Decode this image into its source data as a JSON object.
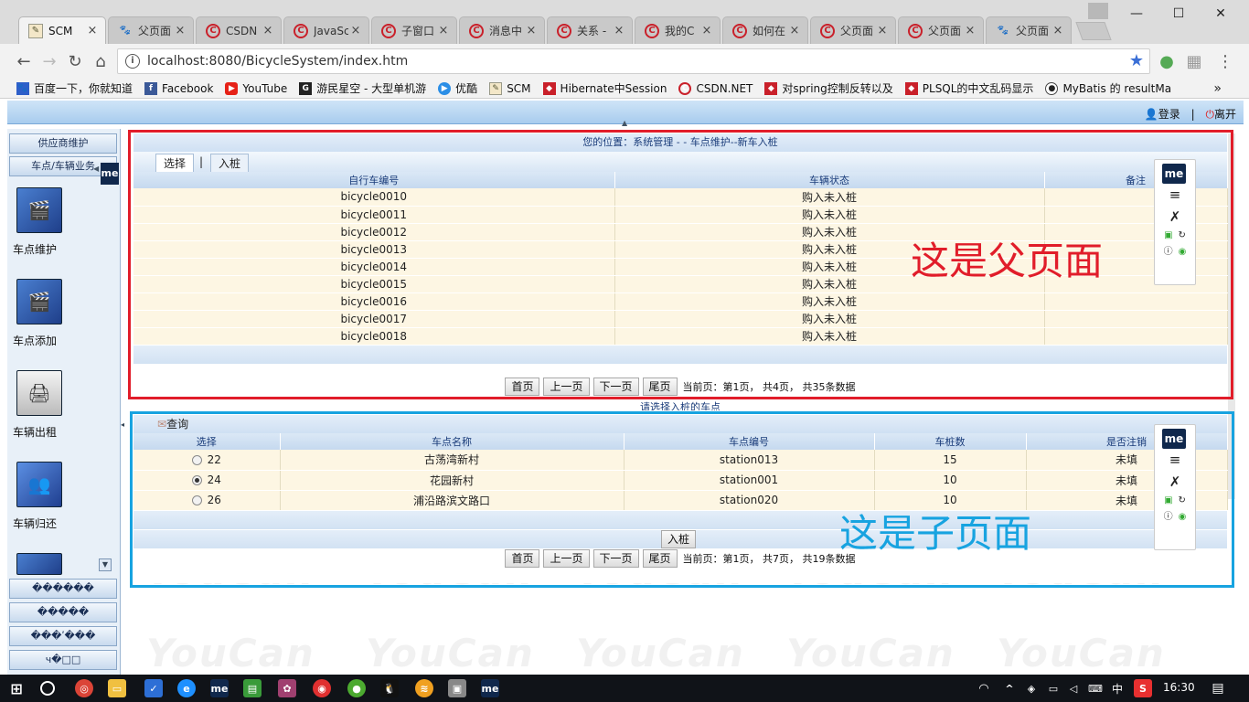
{
  "browser": {
    "tabs": [
      {
        "label": "SCM",
        "icon": "scm-icon",
        "active": true
      },
      {
        "label": "父页面",
        "icon": "baidu-paw-icon"
      },
      {
        "label": "CSDN",
        "icon": "csdn-icon"
      },
      {
        "label": "JavaSc",
        "icon": "csdn-icon"
      },
      {
        "label": "子窗口",
        "icon": "csdn-icon"
      },
      {
        "label": "消息中",
        "icon": "csdn-icon"
      },
      {
        "label": "关系 -",
        "icon": "csdn-icon"
      },
      {
        "label": "我的C",
        "icon": "csdn-icon"
      },
      {
        "label": "如何在",
        "icon": "csdn-icon"
      },
      {
        "label": "父页面",
        "icon": "csdn-icon"
      },
      {
        "label": "父页面",
        "icon": "csdn-icon"
      },
      {
        "label": "父页面",
        "icon": "baidu-paw-icon"
      }
    ],
    "tab_close": "×",
    "url": "localhost:8080/BicycleSystem/index.htm",
    "bookmarks": [
      {
        "label": "百度一下，你就知道"
      },
      {
        "label": "Facebook"
      },
      {
        "label": "YouTube"
      },
      {
        "label": "游民星空 - 大型单机游"
      },
      {
        "label": "优酷"
      },
      {
        "label": "SCM"
      },
      {
        "label": "Hibernate中Session"
      },
      {
        "label": "CSDN.NET"
      },
      {
        "label": "对spring控制反转以及"
      },
      {
        "label": "PLSQL的中文乱码显示"
      },
      {
        "label": "MyBatis 的 resultMa"
      }
    ],
    "bookmarks_more": "»"
  },
  "header": {
    "login": "登录",
    "separator": "|",
    "logout": "离开"
  },
  "sidebar": {
    "top_buttons": [
      "供应商维护",
      "车点/车辆业务"
    ],
    "items": [
      {
        "label": "车点维护"
      },
      {
        "label": "车点添加"
      },
      {
        "label": "车辆出租"
      },
      {
        "label": "车辆归还"
      }
    ],
    "bottom_buttons": [
      "������",
      "�����",
      "���ʹ���",
      "ч�□□"
    ]
  },
  "parent_frame": {
    "breadcrumb": "您的位置：系统管理 -  - 车点维护--新车入桩",
    "tabs": [
      "选择",
      "|",
      "入桩"
    ],
    "columns": [
      "自行车编号",
      "车辆状态",
      "备注"
    ],
    "rows": [
      [
        "bicycle0010",
        "购入未入桩",
        ""
      ],
      [
        "bicycle0011",
        "购入未入桩",
        ""
      ],
      [
        "bicycle0012",
        "购入未入桩",
        ""
      ],
      [
        "bicycle0013",
        "购入未入桩",
        ""
      ],
      [
        "bicycle0014",
        "购入未入桩",
        ""
      ],
      [
        "bicycle0015",
        "购入未入桩",
        ""
      ],
      [
        "bicycle0016",
        "购入未入桩",
        ""
      ],
      [
        "bicycle0017",
        "购入未入桩",
        ""
      ],
      [
        "bicycle0018",
        "购入未入桩",
        ""
      ]
    ],
    "pager": {
      "first": "首页",
      "prev": "上一页",
      "next": "下一页",
      "last": "尾页",
      "info": "当前页：第1页， 共4页， 共35条数据"
    },
    "annotation": "这是父页面"
  },
  "between_caption": "请选择入桩的车点",
  "child_frame": {
    "query": "查询",
    "columns": [
      "选择",
      "车点名称",
      "车点编号",
      "车桩数",
      "是否注销"
    ],
    "rows": [
      {
        "id": "22",
        "name": "古荡湾新村",
        "code": "station013",
        "piles": "15",
        "status": "未填",
        "selected": false
      },
      {
        "id": "24",
        "name": "花园新村",
        "code": "station001",
        "piles": "10",
        "status": "未填",
        "selected": true
      },
      {
        "id": "26",
        "name": "浦沿路滨文路口",
        "code": "station020",
        "piles": "10",
        "status": "未填",
        "selected": false
      }
    ],
    "submit": "入桩",
    "pager": {
      "first": "首页",
      "prev": "上一页",
      "next": "下一页",
      "last": "尾页",
      "info": "当前页：第1页， 共7页， 共19条数据"
    },
    "annotation": "这是子页面"
  },
  "extension": {
    "label": "me"
  },
  "watermark": "YouCan",
  "taskbar": {
    "time": "16:30",
    "ime": "中"
  },
  "colors": {
    "red_box": "#e11d2a",
    "blue_box": "#17a3e0",
    "row_bg": "#fdf6e3",
    "header_blue": "#a8ccee"
  }
}
